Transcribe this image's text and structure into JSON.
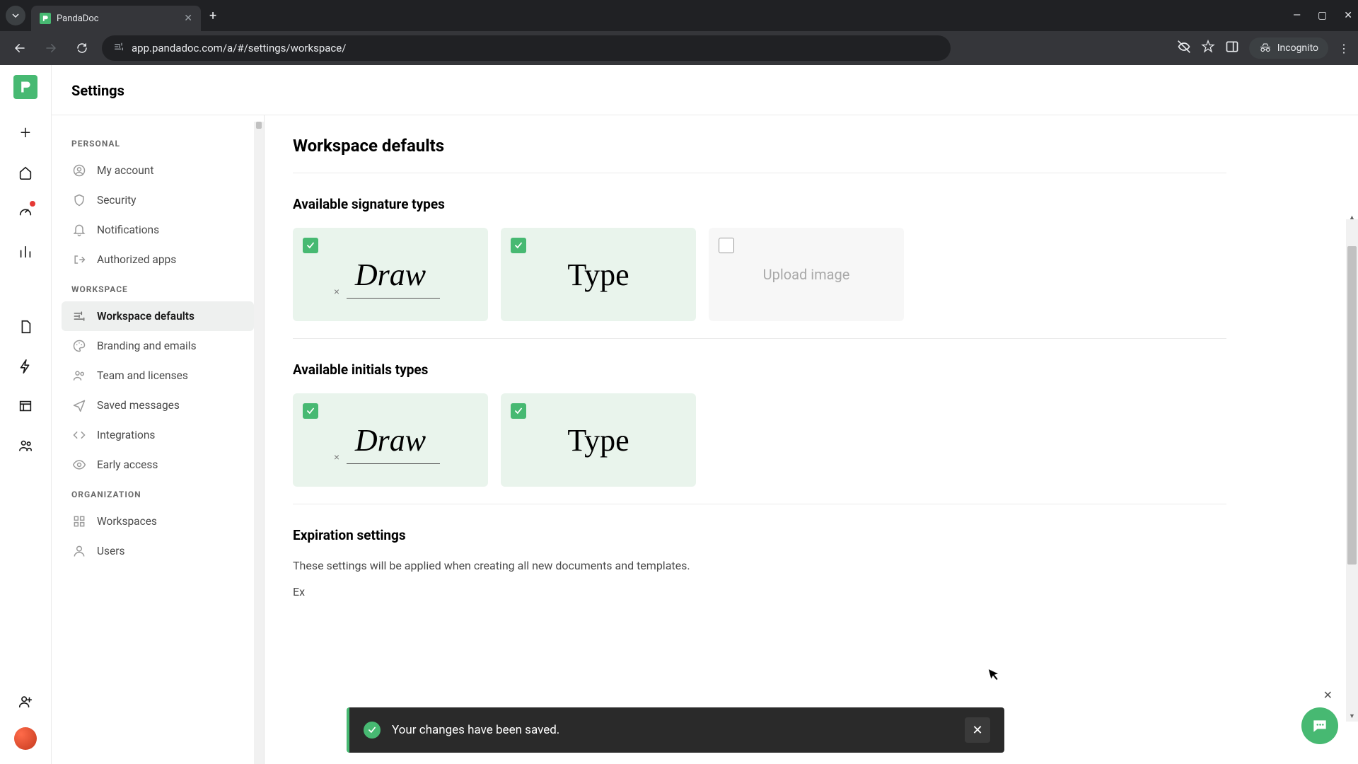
{
  "browser": {
    "tab_title": "PandaDoc",
    "url": "app.pandadoc.com/a/#/settings/workspace/",
    "incognito_label": "Incognito"
  },
  "page": {
    "title": "Settings"
  },
  "sidebar": {
    "sections": {
      "personal": {
        "label": "PERSONAL",
        "items": [
          {
            "label": "My account"
          },
          {
            "label": "Security"
          },
          {
            "label": "Notifications"
          },
          {
            "label": "Authorized apps"
          }
        ]
      },
      "workspace": {
        "label": "WORKSPACE",
        "items": [
          {
            "label": "Workspace defaults",
            "active": true
          },
          {
            "label": "Branding and emails"
          },
          {
            "label": "Team and licenses"
          },
          {
            "label": "Saved messages"
          },
          {
            "label": "Integrations"
          },
          {
            "label": "Early access"
          }
        ]
      },
      "organization": {
        "label": "ORGANIZATION",
        "items": [
          {
            "label": "Workspaces"
          },
          {
            "label": "Users"
          }
        ]
      }
    }
  },
  "content": {
    "heading": "Workspace defaults",
    "signature_section": {
      "title": "Available signature types",
      "options": {
        "draw": {
          "label": "Draw",
          "checked": true
        },
        "type": {
          "label": "Type",
          "checked": true
        },
        "upload": {
          "label": "Upload image",
          "checked": false
        }
      }
    },
    "initials_section": {
      "title": "Available initials types",
      "options": {
        "draw": {
          "label": "Draw",
          "checked": true
        },
        "type": {
          "label": "Type",
          "checked": true
        }
      }
    },
    "expiration_section": {
      "title": "Expiration settings",
      "description": "These settings will be applied when creating all new documents and templates.",
      "partial": "Ex"
    }
  },
  "toast": {
    "message": "Your changes have been saved."
  }
}
